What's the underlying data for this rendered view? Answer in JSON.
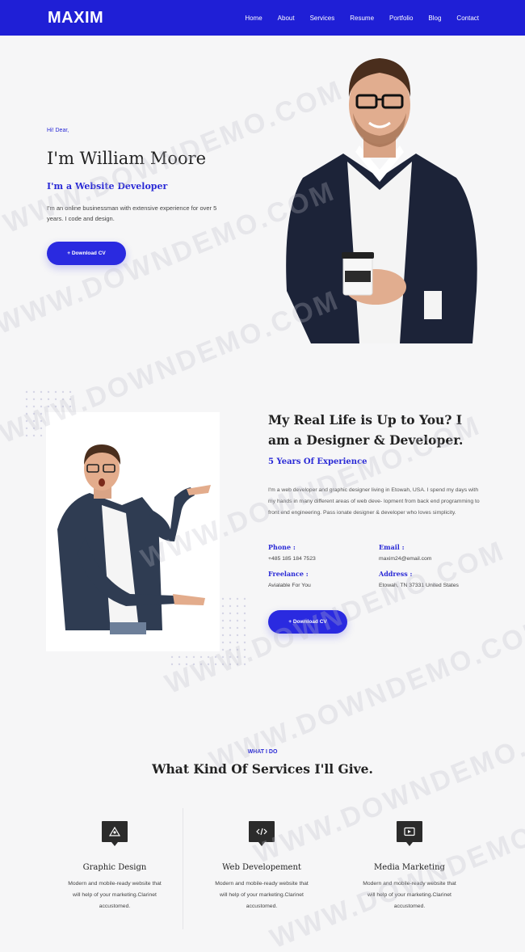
{
  "nav": {
    "logo": "MAXIM",
    "links": [
      "Home",
      "About",
      "Services",
      "Resume",
      "Portfolio",
      "Blog",
      "Contact"
    ]
  },
  "hero": {
    "greeting": "Hi! Dear,",
    "name": "I'm William Moore",
    "role": "I'm a Website Developer",
    "description": "I'm an online businessman with extensive experience for over 5 years. I code and design.",
    "button": "+ Download CV"
  },
  "about": {
    "title": "My Real Life is Up to You? I am a Designer & Developer.",
    "experience": "5 Years Of Experience",
    "description": "I'm a web developer and graphic designer living in Etowah, USA. I spend my days with my hands in many different areas of web deve- lopment from back end programming to front end engineering. Pass ionate designer & developer who loves simplicity.",
    "phone_label": "Phone :",
    "phone": "+485 185 184 7523",
    "email_label": "Email :",
    "email": "maxim24@email.com",
    "freelance_label": "Freelance :",
    "freelance": "Avialable For You",
    "address_label": "Address :",
    "address": "Etowah, TN 37331 United States",
    "button": "+ Download CV"
  },
  "services": {
    "kicker": "WHAT I DO",
    "title": "What Kind Of Services I'll Give.",
    "items": [
      {
        "name": "Graphic Design",
        "description": "Modern and mobile-ready website that will help of your marketing.Clarinet accustomed.",
        "icon": "graphic-design-icon"
      },
      {
        "name": "Web Developement",
        "description": "Modern and mobile-ready website that will help of your marketing.Clarinet accustomed.",
        "icon": "web-development-icon"
      },
      {
        "name": "Media Marketing",
        "description": "Modern and mobile-ready website that will help of your marketing.Clarinet accustomed.",
        "icon": "media-marketing-icon"
      }
    ]
  },
  "watermark": "WWW.DOWNDEMO.COM",
  "colors": {
    "brand": "#1f1fd6",
    "accent": "#2a2ad6"
  }
}
